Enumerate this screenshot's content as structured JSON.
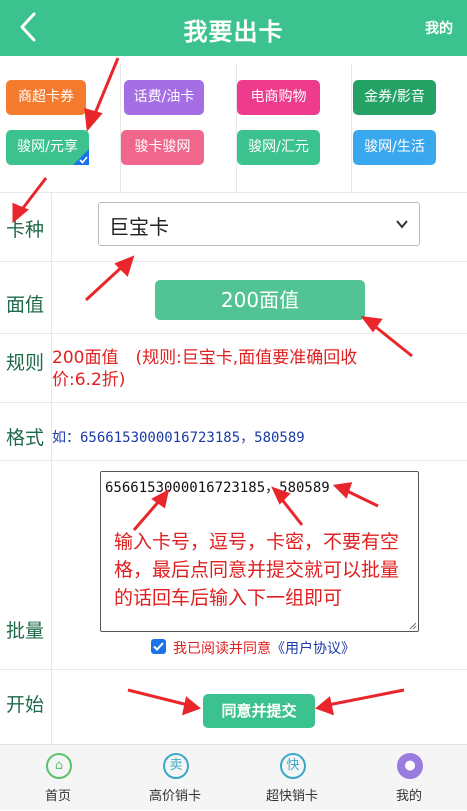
{
  "header": {
    "title": "我要出卡",
    "mine": "我的"
  },
  "categories": [
    {
      "label": "商超卡券",
      "color": "#f47a2d"
    },
    {
      "label": "话费/油卡",
      "color": "#a56ee4"
    },
    {
      "label": "电商购物",
      "color": "#ee3b8c"
    },
    {
      "label": "金券/影音",
      "color": "#24a266"
    },
    {
      "label": "骏网/元享",
      "color": "#3cc28f",
      "selected": true
    },
    {
      "label": "骏卡骏网",
      "color": "#f0668c"
    },
    {
      "label": "骏网/汇元",
      "color": "#3cc28f"
    },
    {
      "label": "骏网/生活",
      "color": "#3aa8ee"
    }
  ],
  "labels": {
    "card_type": "卡种",
    "face_value": "面值",
    "rule": "规则",
    "format": "格式",
    "batch": "批量",
    "start": "开始"
  },
  "card_type": {
    "value": "巨宝卡"
  },
  "face_value": {
    "value": "200面值"
  },
  "rule": {
    "text": "200面值　(规则:巨宝卡,面值要准确回收价:6.2折)"
  },
  "format": {
    "text": "如：6566153000016723185，580589"
  },
  "batch": {
    "value": "6566153000016723185，580589",
    "hint": "输入卡号，逗号，卡密，不要有空格，最后点同意并提交就可以批量的话回车后输入下一组即可"
  },
  "agree": {
    "checked": true,
    "text": "我已阅读并同意",
    "link": "《用户协议》"
  },
  "submit": {
    "label": "同意并提交"
  },
  "tabbar": [
    {
      "label": "首页",
      "icon": "home-icon",
      "glyph": "⌂",
      "color": "#5cc36c"
    },
    {
      "label": "高价销卡",
      "icon": "sell-icon",
      "glyph": "卖",
      "color": "#3aa8c8"
    },
    {
      "label": "超快销卡",
      "icon": "fast-icon",
      "glyph": "快",
      "color": "#3aa8c8"
    },
    {
      "label": "我的",
      "icon": "user-icon",
      "glyph": "●",
      "color": "#9a7be0"
    }
  ]
}
